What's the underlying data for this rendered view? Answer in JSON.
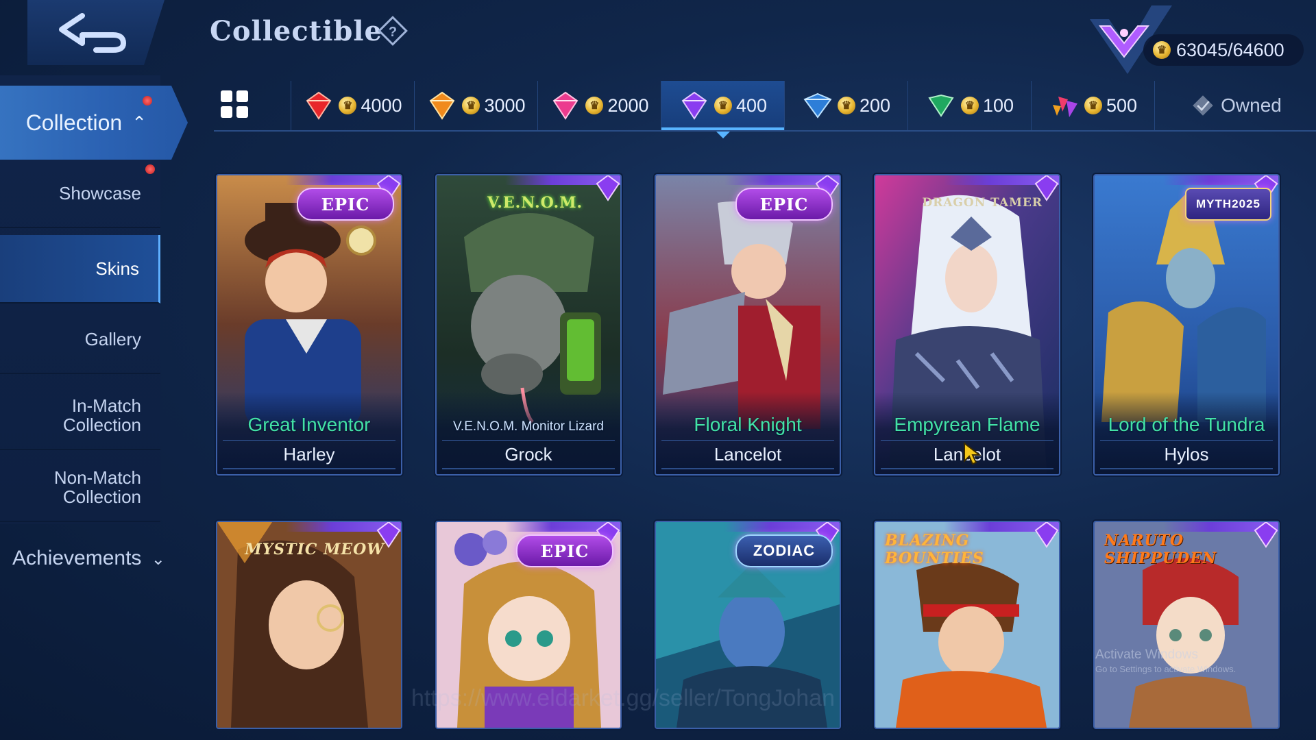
{
  "header": {
    "title": "Collectible",
    "currency": "63045/64600"
  },
  "sidebar": {
    "collection": "Collection",
    "items": [
      {
        "label": "Showcase"
      },
      {
        "label": "Skins"
      },
      {
        "label": "Gallery"
      },
      {
        "label": "In-Match\nCollection"
      },
      {
        "label": "Non-Match\nCollection"
      }
    ],
    "achievements": "Achievements"
  },
  "tabs": [
    {
      "value": "4000",
      "gem": "red-gem-icon"
    },
    {
      "value": "3000",
      "gem": "orange-gem-icon"
    },
    {
      "value": "2000",
      "gem": "pink-gem-icon"
    },
    {
      "value": "400",
      "gem": "purple-gem-icon"
    },
    {
      "value": "200",
      "gem": "blue-gem-icon"
    },
    {
      "value": "100",
      "gem": "green-gem-icon"
    },
    {
      "value": "500",
      "gem": "multicolor-gem-icon"
    },
    {
      "value": "Owned",
      "gem": "gray-gem-icon"
    }
  ],
  "cards": [
    {
      "badge": "EPIC",
      "skin": "Great Inventor",
      "hero": "Harley"
    },
    {
      "badge": "V.E.N.O.M.",
      "skin": "V.E.N.O.M. Monitor Lizard",
      "hero": "Grock"
    },
    {
      "badge": "EPIC",
      "skin": "Floral Knight",
      "hero": "Lancelot"
    },
    {
      "badge": "DRAGON TAMER",
      "skin": "Empyrean Flame",
      "hero": "Lancelot"
    },
    {
      "badge": "MYTH2025",
      "skin": "Lord of the Tundra",
      "hero": "Hylos"
    },
    {
      "badge": "MYSTIC MEOW"
    },
    {
      "badge": "EPIC"
    },
    {
      "badge": "ZODIAC"
    },
    {
      "badge": "BLAZING BOUNTIES"
    },
    {
      "badge": "NARUTO SHIPPUDEN"
    }
  ],
  "watermarks": {
    "windows_title": "Activate Windows",
    "windows_sub": "Go to Settings to activate Windows.",
    "url": "https://www.eldarket.gg/seller/TongJohan"
  },
  "colors": {
    "accent": "#58b4ff",
    "skin_name": "#43e2a6",
    "epic_badge": "#b14ce8"
  }
}
